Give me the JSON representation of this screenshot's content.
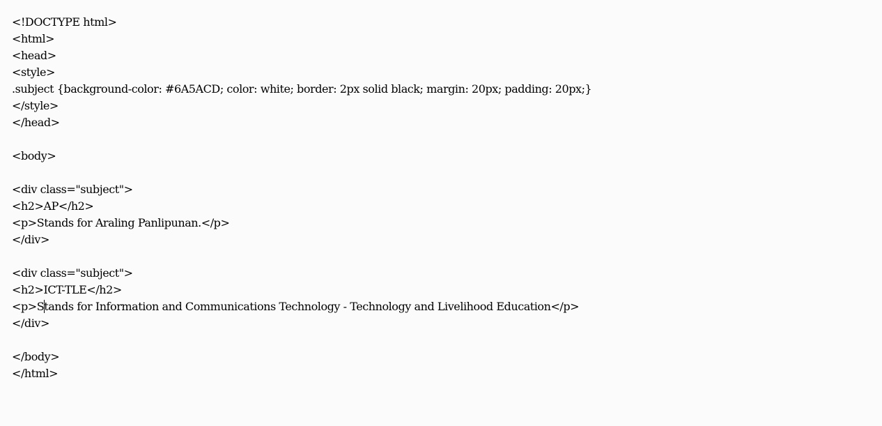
{
  "document": {
    "lines": [
      "<!DOCTYPE html>",
      "<html>",
      "<head>",
      "<style>",
      ".subject {background-color: #6A5ACD; color: white; border: 2px solid black; margin: 20px; padding: 20px;}",
      "</style>",
      "</head>",
      "",
      "<body>",
      "",
      "<div class=\"subject\">",
      "<h2>AP</h2>",
      "<p>Stands for Araling Panlipunan.</p>",
      "</div>",
      "",
      "<div class=\"subject\">",
      "<h2>ICT-TLE</h2>",
      "<p>Stands for Information and Communications Technology - Technology and Livelihood Education</p>",
      "</div>",
      "",
      "</body>",
      "</html>"
    ],
    "caret_line": 17,
    "caret_before_char": "<p>S",
    "text_color": "#000000",
    "background_color": "#fbfbfb"
  }
}
